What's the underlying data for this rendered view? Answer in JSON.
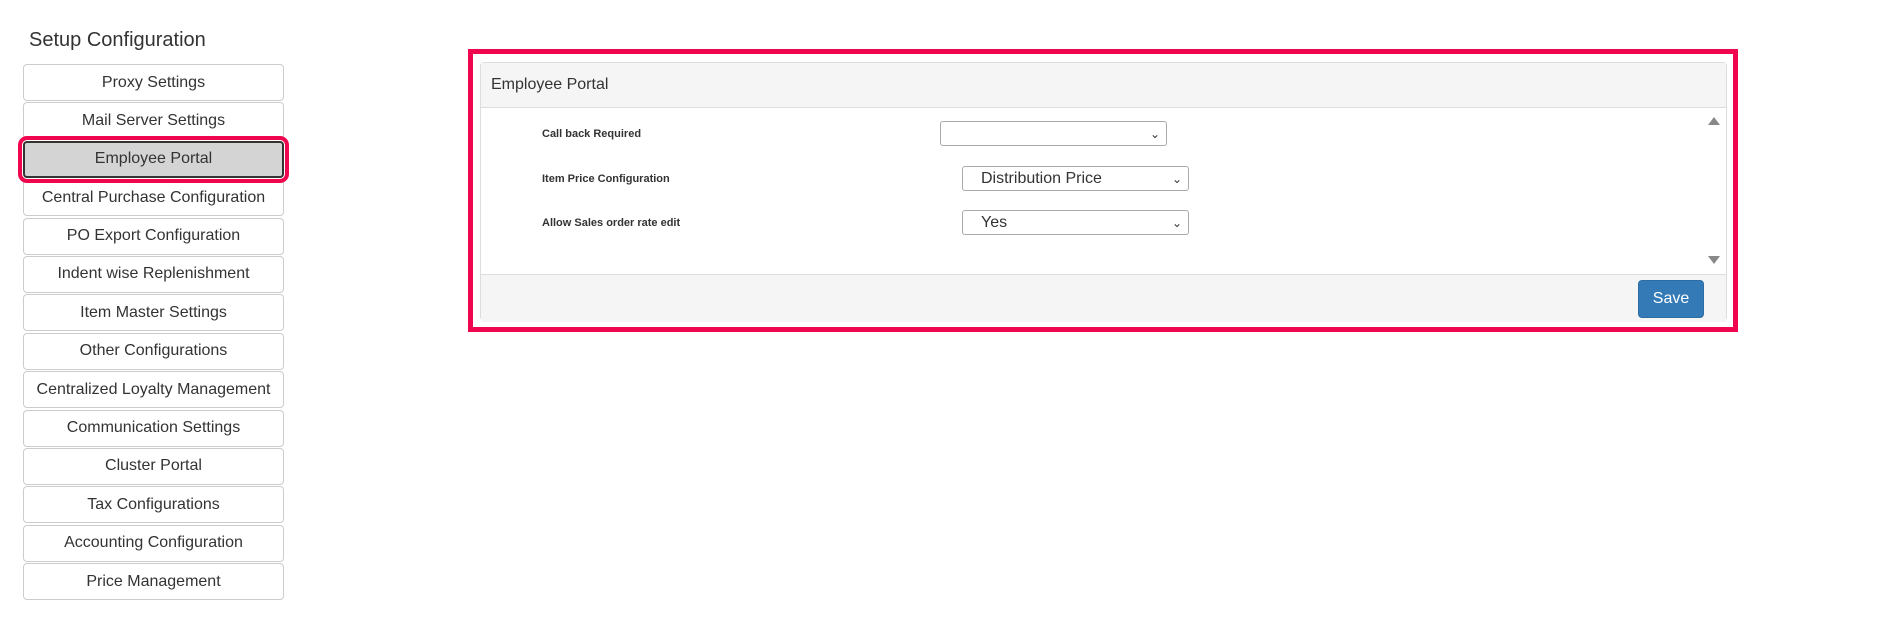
{
  "sidebar": {
    "title": "Setup Configuration",
    "items": [
      {
        "label": "Proxy Settings"
      },
      {
        "label": "Mail Server Settings"
      },
      {
        "label": "Employee Portal"
      },
      {
        "label": "Central Purchase Configuration"
      },
      {
        "label": "PO Export Configuration"
      },
      {
        "label": "Indent wise Replenishment"
      },
      {
        "label": "Item Master Settings"
      },
      {
        "label": "Other Configurations"
      },
      {
        "label": "Centralized Loyalty Management"
      },
      {
        "label": "Communication Settings"
      },
      {
        "label": "Cluster Portal"
      },
      {
        "label": "Tax Configurations"
      },
      {
        "label": "Accounting Configuration"
      },
      {
        "label": "Price Management"
      }
    ],
    "active": "Employee Portal"
  },
  "panel": {
    "heading": "Employee Portal",
    "fields": [
      {
        "label": "Call back Required",
        "value": ""
      },
      {
        "label": "Item Price Configuration",
        "value": "Distribution Price"
      },
      {
        "label": "Allow Sales order rate edit",
        "value": "Yes"
      }
    ],
    "save_label": "Save"
  },
  "colors": {
    "highlight": "#f0064f",
    "primary_button": "#337ab7",
    "panel_bg": "#f5f5f5"
  }
}
